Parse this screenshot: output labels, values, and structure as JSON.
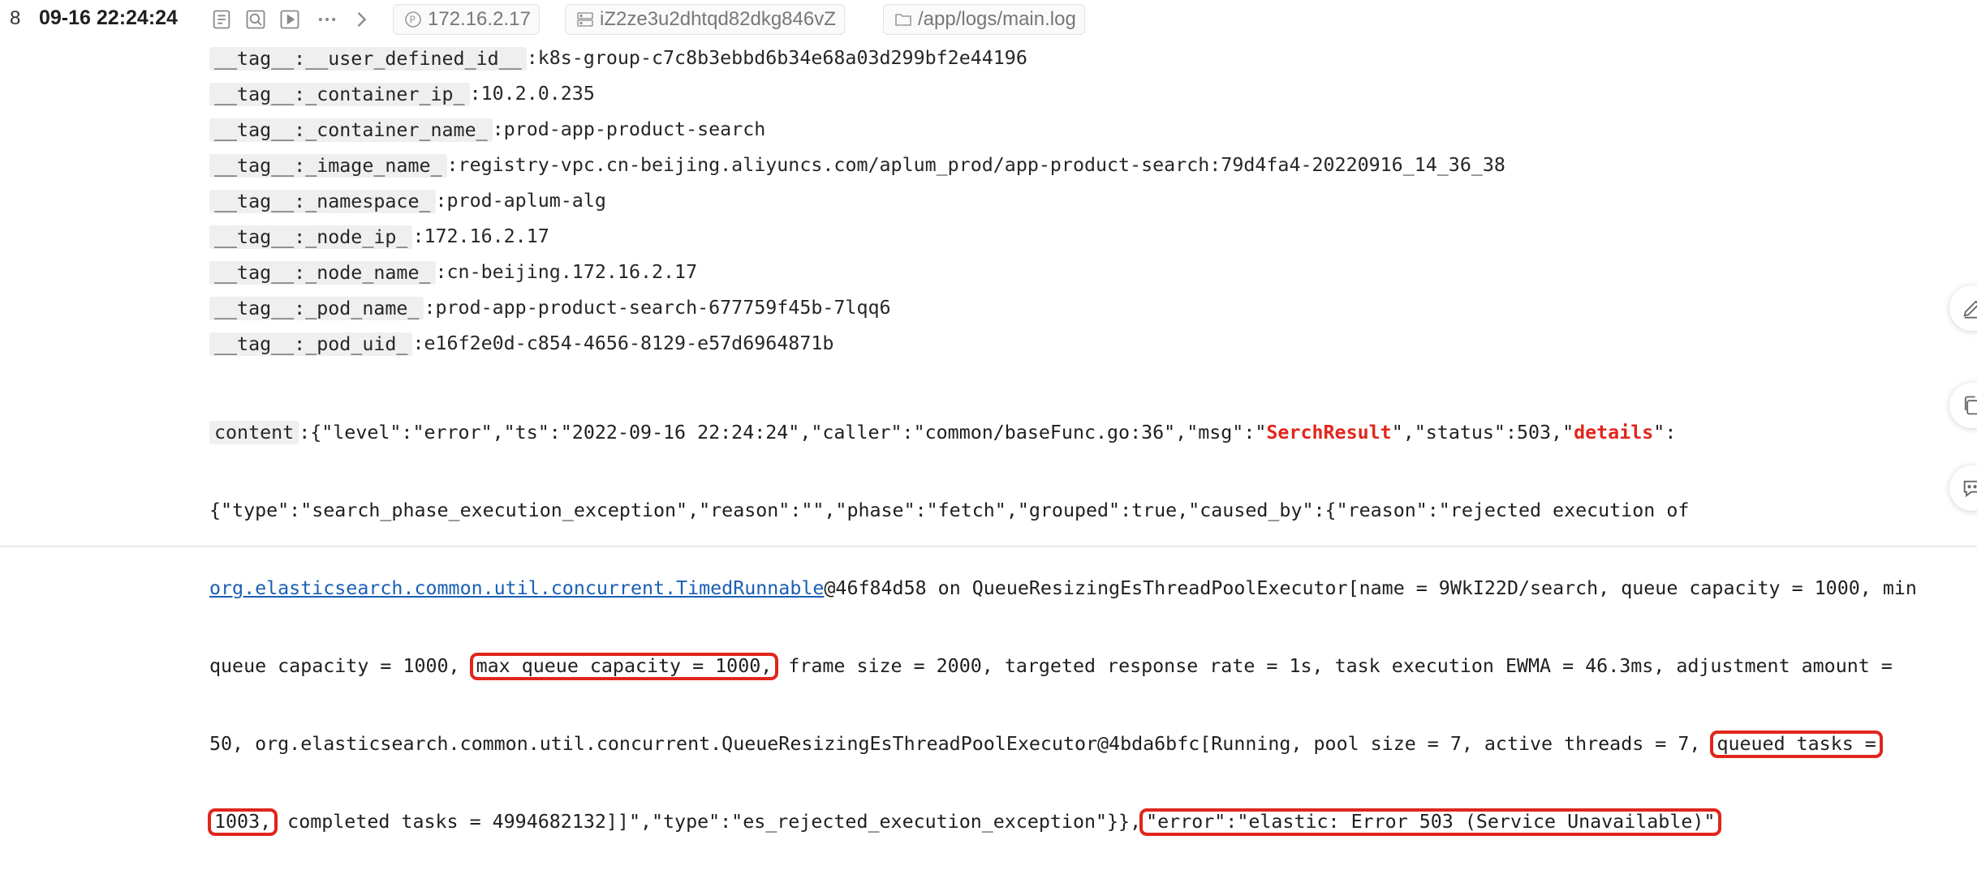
{
  "header": {
    "row_number": "8",
    "timestamp": "09-16 22:24:24",
    "icons": [
      "document-icon",
      "search-context-icon",
      "play-icon",
      "more-icon",
      "chevron-right-icon"
    ],
    "ip_pill": "172.16.2.17",
    "host_pill": "iZ2ze3u2dhtqd82dkg846vZ",
    "path_pill": "/app/logs/main.log"
  },
  "tags": [
    {
      "key": "__tag__:__user_defined_id__",
      "value": ":k8s-group-c7c8b3ebbd6b34e68a03d299bf2e44196"
    },
    {
      "key": "__tag__:_container_ip_",
      "value": ":10.2.0.235"
    },
    {
      "key": "__tag__:_container_name_",
      "value": ":prod-app-product-search"
    },
    {
      "key": "__tag__:_image_name_",
      "value": ":registry-vpc.cn-beijing.aliyuncs.com/aplum_prod/app-product-search:79d4fa4-20220916_14_36_38"
    },
    {
      "key": "__tag__:_namespace_",
      "value": ":prod-aplum-alg"
    },
    {
      "key": "__tag__:_node_ip_",
      "value": ":172.16.2.17"
    },
    {
      "key": "__tag__:_node_name_",
      "value": ":cn-beijing.172.16.2.17"
    },
    {
      "key": "__tag__:_pod_name_",
      "value": ":prod-app-product-search-677759f45b-7lqq6"
    },
    {
      "key": "__tag__:_pod_uid_",
      "value": ":e16f2e0d-c854-4656-8129-e57d6964871b"
    }
  ],
  "content": {
    "key": "content",
    "line1_a": ":{\"level\":\"error\",\"ts\":\"2022-09-16 22:24:24\",\"caller\":\"common/baseFunc.go:36\",\"msg\":\"",
    "line1_kw1": "SerchResult",
    "line1_b": "\",\"status\":503,\"",
    "line1_kw2": "details",
    "line1_c": "\":",
    "line2": "{\"type\":\"search_phase_execution_exception\",\"reason\":\"\",\"phase\":\"fetch\",\"grouped\":true,\"caused_by\":{\"reason\":\"rejected execution of",
    "line3_link": "org.elasticsearch.common.util.concurrent.TimedRunnable",
    "line3_rest": "@46f84d58 on QueueResizingEsThreadPoolExecutor[name = 9WkI22D/search, queue capacity = 1000, min",
    "line4_a": "queue capacity = 1000,",
    "line4_hl": "max queue capacity = 1000,",
    "line4_b": " frame size = 2000, targeted response rate = 1s, task execution EWMA = 46.3ms, adjustment amount =",
    "line5_a": "50, org.elasticsearch.common.util.concurrent.QueueResizingEsThreadPoolExecutor@4bda6bfc[Running, pool size = 7, active threads = 7,",
    "line5_hl": "queued tasks =",
    "line6_hl": "1003,",
    "line6_a": " completed tasks = 4994682132]]\",\"type\":\"es_rejected_execution_exception\"}},",
    "line6_hl2": "\"error\":\"elastic: Error 503 (Service Unavailable)\""
  },
  "colors": {
    "highlight_red": "#e0261b",
    "link_blue": "#1a5fb4",
    "key_bg": "#efefef"
  }
}
